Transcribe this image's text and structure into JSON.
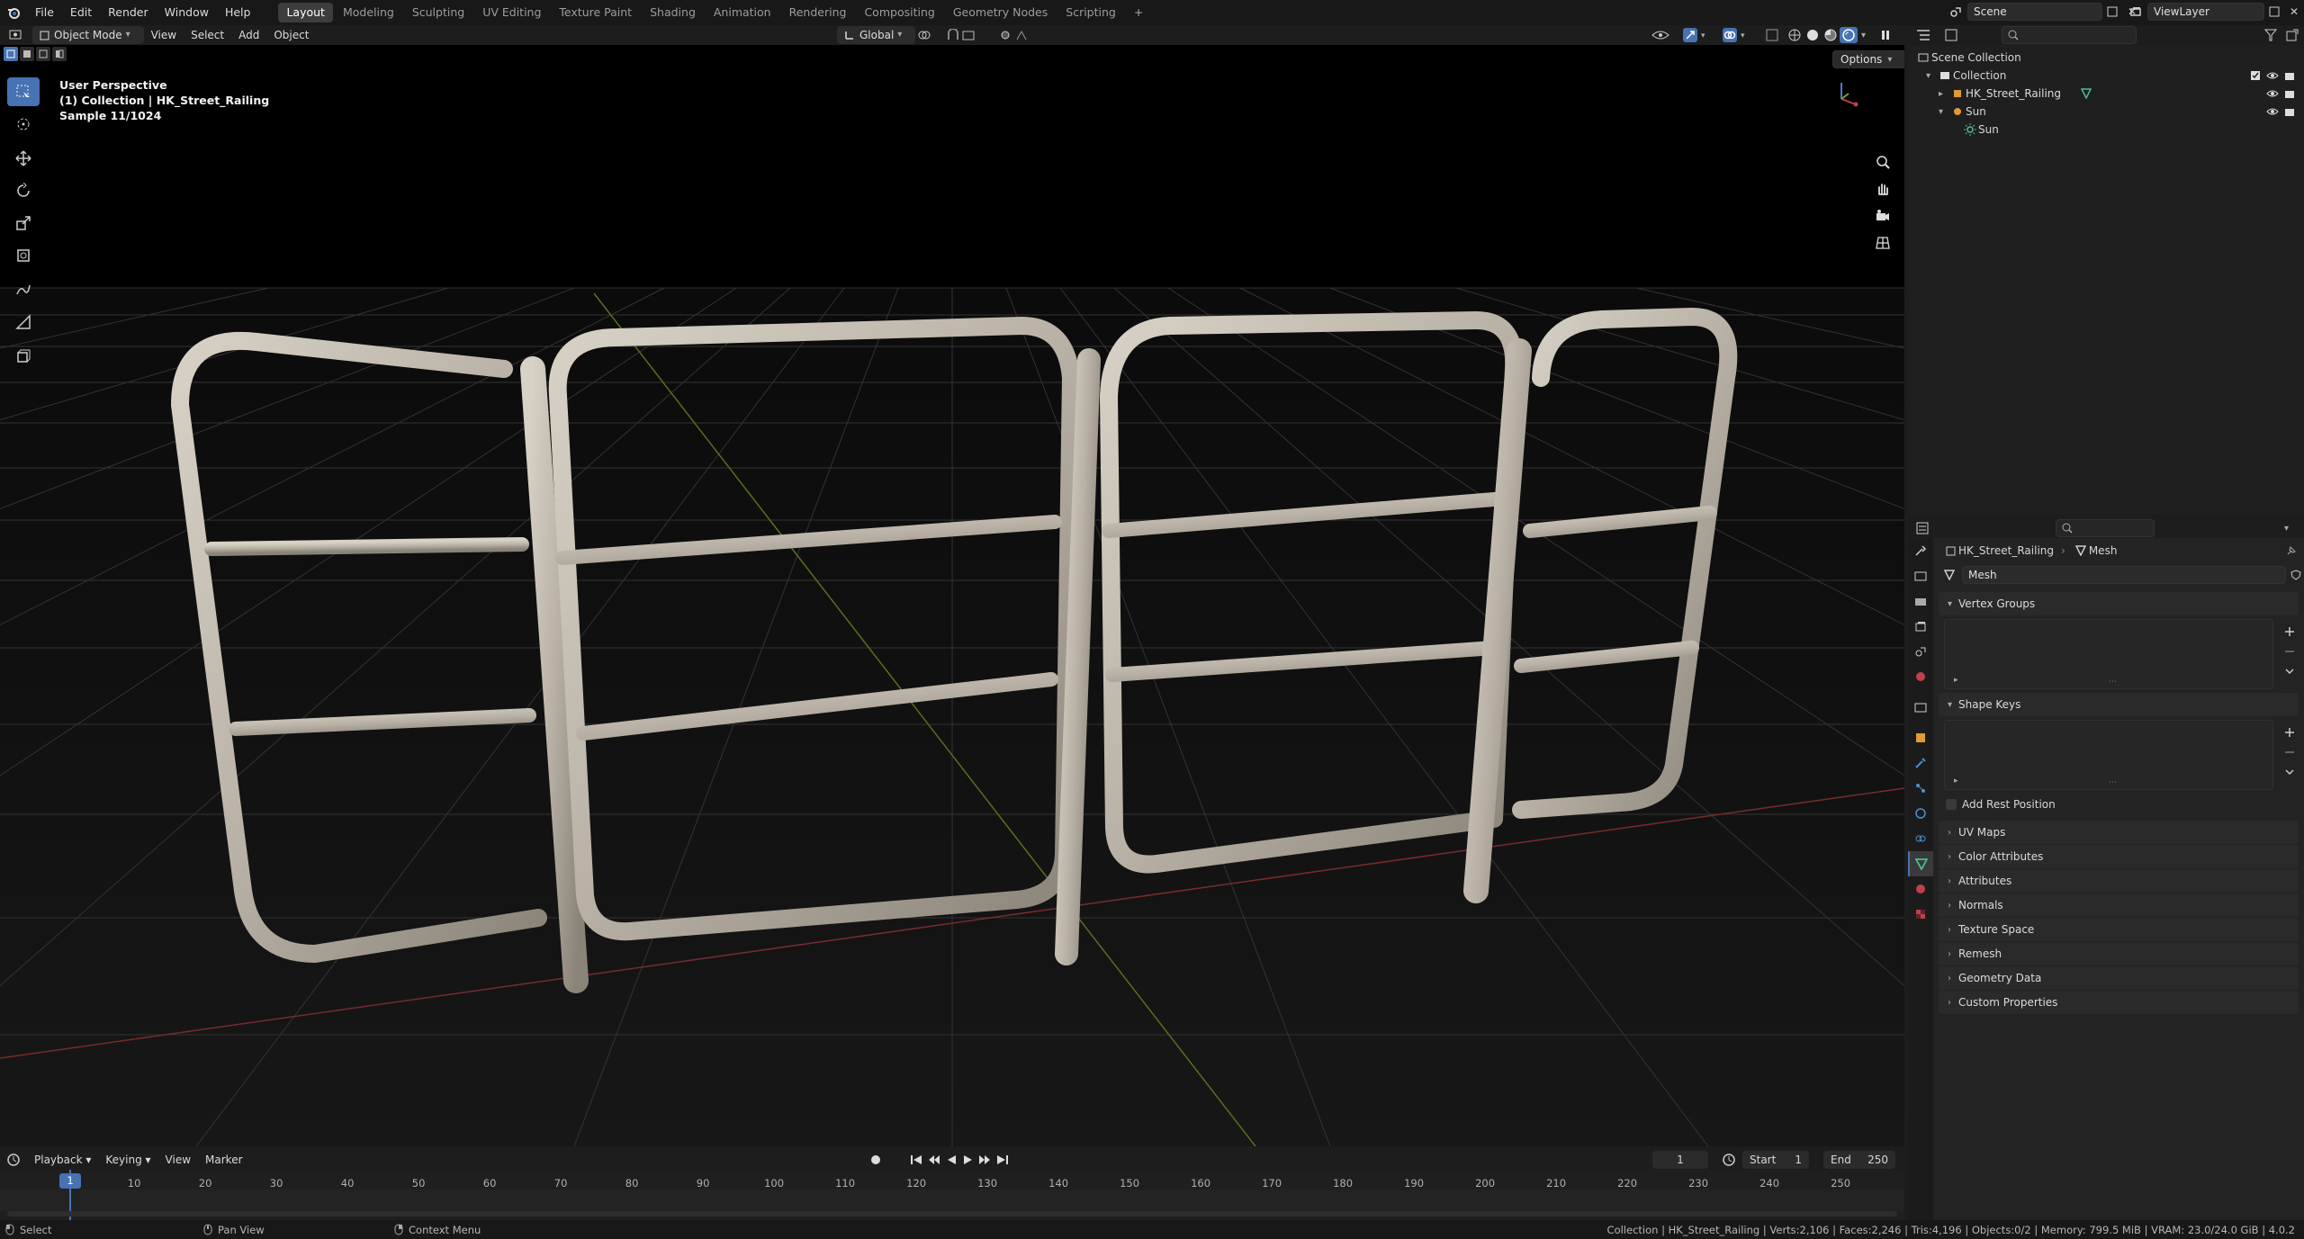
{
  "topbar": {
    "menus": [
      "File",
      "Edit",
      "Render",
      "Window",
      "Help"
    ],
    "workspaces": [
      "Layout",
      "Modeling",
      "Sculpting",
      "UV Editing",
      "Texture Paint",
      "Shading",
      "Animation",
      "Rendering",
      "Compositing",
      "Geometry Nodes",
      "Scripting"
    ],
    "active_workspace": "Layout",
    "scene": "Scene",
    "view_layer": "ViewLayer"
  },
  "viewport_header": {
    "mode": "Object Mode",
    "menus": [
      "View",
      "Select",
      "Add",
      "Object"
    ],
    "transform_orientation": "Global",
    "options_label": "Options"
  },
  "viewport": {
    "overlay_lines": [
      "User Perspective",
      "(1) Collection | HK_Street_Railing",
      "Sample 11/1024"
    ]
  },
  "outliner": {
    "root": "Scene Collection",
    "items": [
      {
        "label": "Collection",
        "depth": 1
      },
      {
        "label": "HK_Street_Railing",
        "depth": 2
      },
      {
        "label": "Sun",
        "depth": 2
      },
      {
        "label": "Sun",
        "depth": 3
      }
    ]
  },
  "properties": {
    "breadcrumb_object": "HK_Street_Railing",
    "breadcrumb_data": "Mesh",
    "mesh_name": "Mesh",
    "panels": {
      "vertex_groups": "Vertex Groups",
      "shape_keys": "Shape Keys",
      "add_rest_position": "Add Rest Position"
    },
    "collapsed_panels": [
      "UV Maps",
      "Color Attributes",
      "Attributes",
      "Normals",
      "Texture Space",
      "Remesh",
      "Geometry Data",
      "Custom Properties"
    ]
  },
  "timeline": {
    "menus": [
      "Playback",
      "Keying",
      "View",
      "Marker"
    ],
    "current_frame": "1",
    "start_label": "Start",
    "start": "1",
    "end_label": "End",
    "end": "250",
    "ticks": [
      "1",
      "10",
      "20",
      "30",
      "40",
      "50",
      "60",
      "70",
      "80",
      "90",
      "100",
      "110",
      "120",
      "130",
      "140",
      "150",
      "160",
      "170",
      "180",
      "190",
      "200",
      "210",
      "220",
      "230",
      "240",
      "250"
    ]
  },
  "statusbar": {
    "select": "Select",
    "pan_view": "Pan View",
    "context_menu": "Context Menu",
    "stats": "Collection | HK_Street_Railing | Verts:2,106 | Faces:2,246 | Tris:4,196 | Objects:0/2 | Memory: 799.5 MiB | VRAM: 23.0/24.0 GiB | 4.0.2"
  },
  "colors": {
    "accent": "#4772b3",
    "active_frame": "#4772b3",
    "x_axis": "#c0404a",
    "y_axis": "#7ea02a",
    "mesh_icon": "#4fbf8f",
    "object_icon": "#e09a3a"
  }
}
